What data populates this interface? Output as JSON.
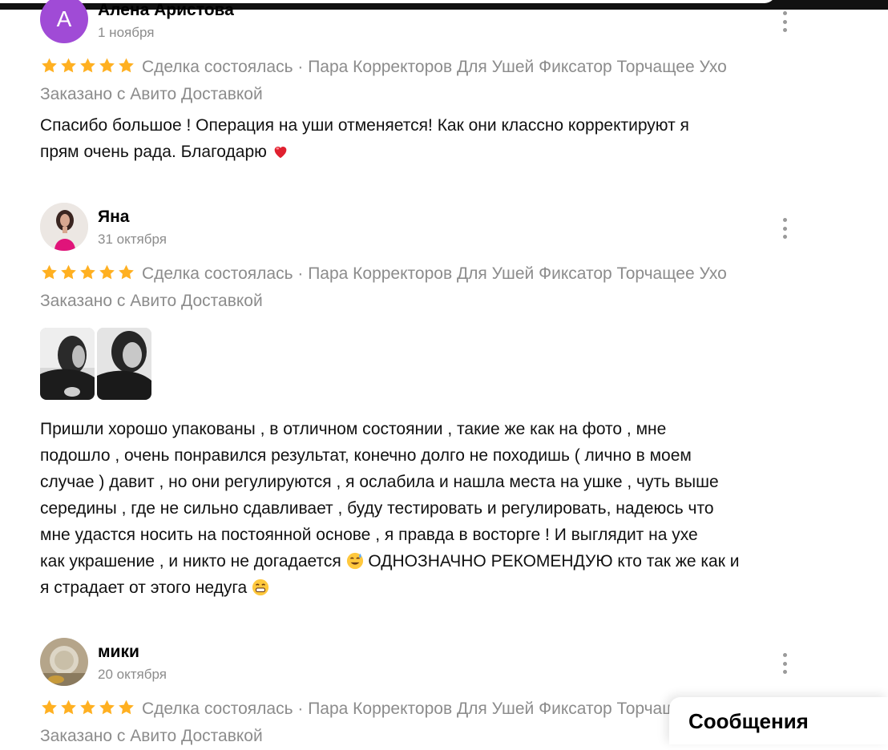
{
  "reviews": [
    {
      "author": "Алена Аристова",
      "avatar_letter": "А",
      "date": "1 ноября",
      "rating": 5,
      "deal": "Сделка состоялась · Пара Корректоров Для Ушей Фиксатор Торчащее Ухо",
      "delivery": "Заказано с Авито Доставкой",
      "text_lines": [
        "Спасибо большое ! Операция на уши отменяется! Как они классно корректируют я",
        "прям очень рада. Благодарю"
      ]
    },
    {
      "author": "Яна",
      "date": "31 октября",
      "rating": 5,
      "deal": "Сделка состоялась · Пара Корректоров Для Ушей Фиксатор Торчащее Ухо",
      "delivery": "Заказано с Авито Доставкой",
      "text_lines": [
        "Пришли хорошо упакованы , в отличном состоянии , такие же как на фото , мне",
        "подошло , очень понравился результат, конечно долго не походишь ( лично в моем",
        "случае ) давит , но они регулируются , я ослабила и нашла места на ушке , чуть выше",
        "середины , где не сильно сдавливает , буду тестировать и регулировать, надеюсь что",
        "мне удастся носить на постоянной основе , я правда в восторге ! И выглядит на ухе",
        "как украшение , и никто не догадается",
        "ОДНОЗНАЧНО РЕКОМЕНДУЮ кто так же как и",
        "я страдает от этого недуга"
      ]
    },
    {
      "author": "мики",
      "date": "20 октября",
      "rating": 5,
      "deal": "Сделка состоялась · Пара Корректоров Для Ушей Фиксатор Торчащее Ухо",
      "delivery": "Заказано с Авито Доставкой"
    }
  ],
  "messages_label": "Сообщения",
  "colors": {
    "star": "#ffb021",
    "meta": "#8c8c8c",
    "avatar_letter_bg": "#a04bd6"
  }
}
